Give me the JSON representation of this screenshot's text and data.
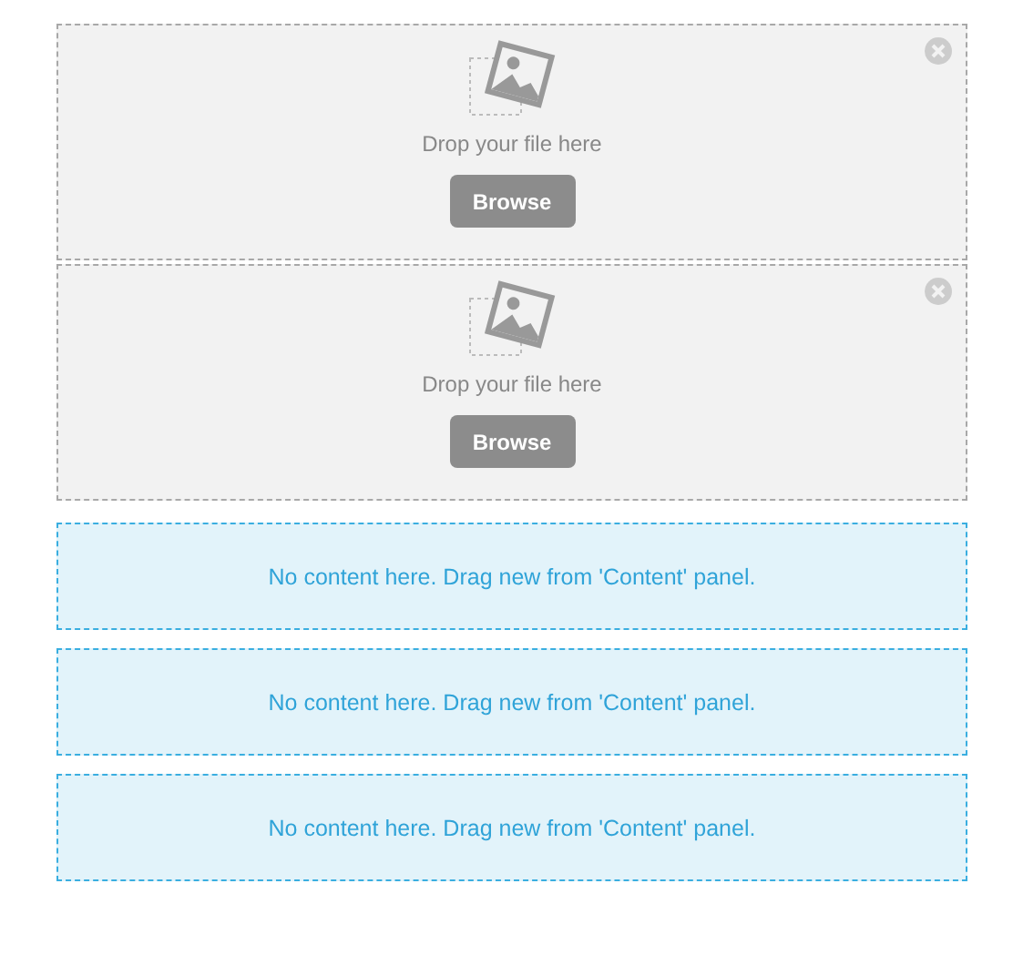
{
  "blocks": [
    {
      "kind": "upload",
      "hint": "Drop your file here",
      "button": "Browse"
    },
    {
      "kind": "upload",
      "hint": "Drop your file here",
      "button": "Browse"
    },
    {
      "kind": "empty",
      "message": "No content here. Drag new from 'Content' panel."
    },
    {
      "kind": "empty",
      "message": "No content here. Drag new from 'Content' panel."
    },
    {
      "kind": "empty",
      "message": "No content here. Drag new from 'Content' panel."
    }
  ]
}
